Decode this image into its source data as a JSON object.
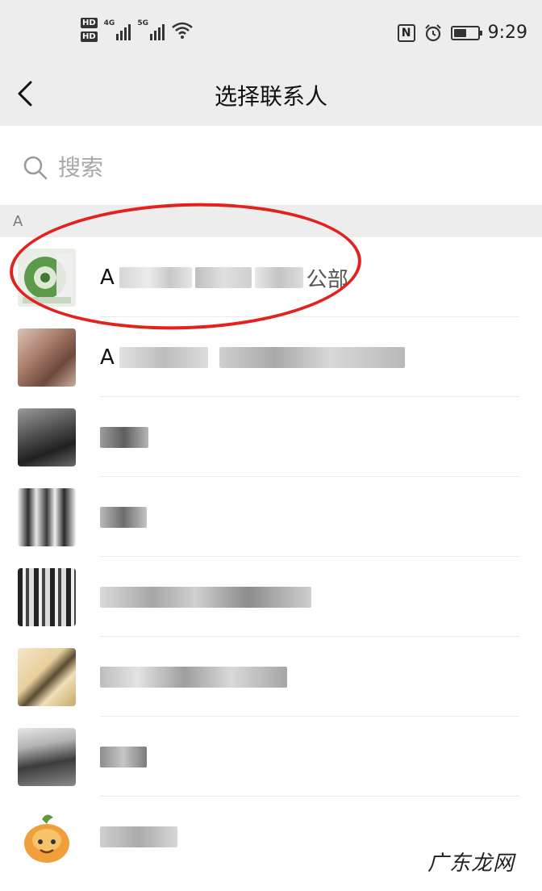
{
  "status_bar": {
    "network_badges": [
      "HD",
      "HD"
    ],
    "signal_labels": [
      "4G",
      "5G"
    ],
    "time": "9:29",
    "battery_level": 0.55,
    "icons": [
      "nfc-icon",
      "alarm-icon",
      "battery-icon",
      "wifi-icon"
    ]
  },
  "header": {
    "title": "选择联系人",
    "back_icon": "chevron-left-icon"
  },
  "search": {
    "placeholder": "搜索",
    "icon": "search-icon"
  },
  "section": {
    "letter": "A"
  },
  "contacts": [
    {
      "visible_prefix": "A",
      "visible_suffix": "公部",
      "highlighted": true
    },
    {
      "visible_prefix": "A",
      "visible_suffix": "",
      "highlighted": false
    },
    {
      "visible_prefix": "",
      "visible_suffix": "",
      "highlighted": false
    },
    {
      "visible_prefix": "",
      "visible_suffix": "",
      "highlighted": false
    },
    {
      "visible_prefix": "",
      "visible_suffix": "",
      "highlighted": false
    },
    {
      "visible_prefix": "",
      "visible_suffix": "",
      "highlighted": false
    },
    {
      "visible_prefix": "",
      "visible_suffix": "",
      "highlighted": false
    },
    {
      "visible_prefix": "",
      "visible_suffix": "",
      "highlighted": false
    }
  ],
  "watermark": "广东龙网",
  "colors": {
    "bar_bg": "#ededed",
    "highlight_ring": "#e3221f",
    "placeholder": "#a8a8a8"
  }
}
